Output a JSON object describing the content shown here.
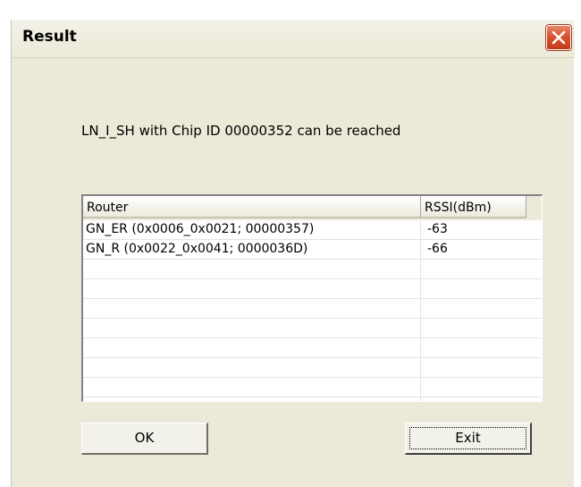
{
  "window": {
    "title": "Result"
  },
  "message": "LN_I_SH with Chip ID 00000352 can be reached",
  "table": {
    "columns": [
      "Router",
      "RSSI(dBm)"
    ],
    "rows": [
      {
        "router": "GN_ER (0x0006_0x0021; 00000357)",
        "rssi": "-63"
      },
      {
        "router": "GN_R (0x0022_0x0041; 0000036D)",
        "rssi": "-66"
      }
    ]
  },
  "buttons": {
    "ok_label": "OK",
    "exit_label": "Exit"
  },
  "icons": {
    "close": "close-icon"
  },
  "colors": {
    "dialog_bg": "#ece9d8",
    "close_button": "#d8502c"
  }
}
